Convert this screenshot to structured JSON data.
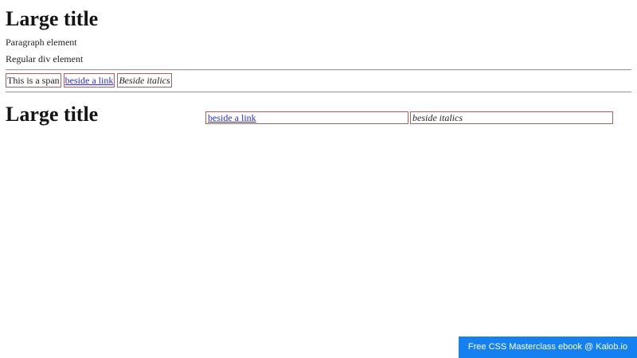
{
  "page": {
    "background": "#ffffff",
    "text_color": "#1f1f1f",
    "box_border_color": "#ad5f5f",
    "link_color": "#2b2bd0",
    "hr_color": "#9e9e9e"
  },
  "section1": {
    "title": "Large title",
    "paragraph": "Paragraph element",
    "div_text": "Regular div element",
    "span_text": "This is a span",
    "link_label": "beside a link",
    "italic_text": "Beside italics"
  },
  "section2": {
    "title": "Large title",
    "link_label": "beside a link",
    "italic_text": "beside italics"
  },
  "badge": {
    "label": "Free CSS Masterclass ebook @ Kalob.io",
    "background": "#1581f0",
    "text_color": "#ffffff"
  }
}
